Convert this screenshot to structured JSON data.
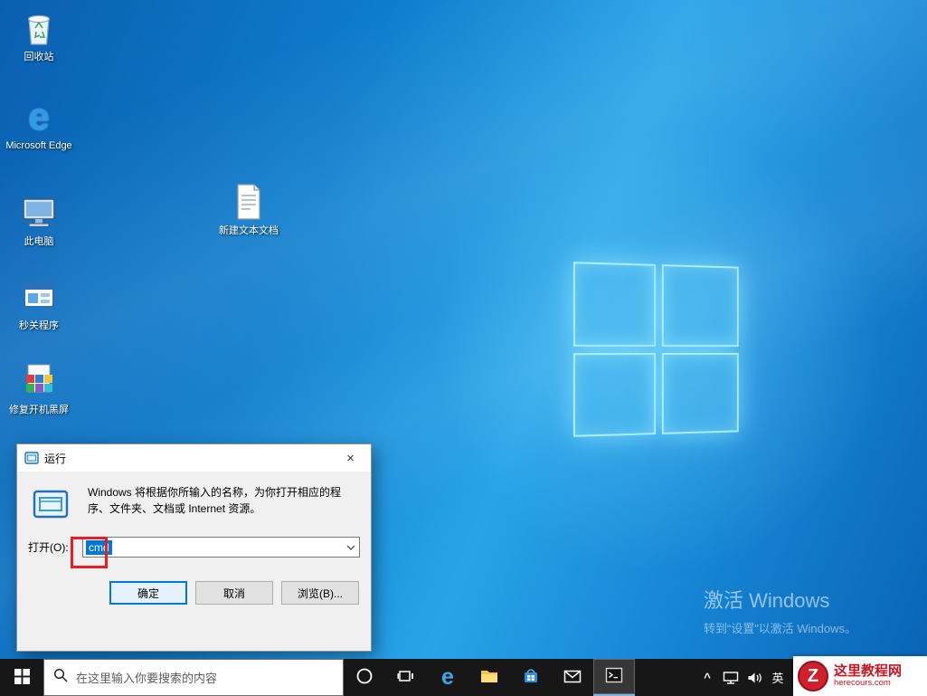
{
  "desktop": {
    "icons": [
      {
        "label": "回收站"
      },
      {
        "label": "Microsoft Edge"
      },
      {
        "label": "此电脑"
      },
      {
        "label": "秒关程序"
      },
      {
        "label": "修复开机黑屏"
      },
      {
        "label": "新建文本文档"
      }
    ],
    "activation": {
      "line1": "激活 Windows",
      "line2": "转到“设置”以激活 Windows。"
    }
  },
  "run_dialog": {
    "title": "运行",
    "description": "Windows 将根据你所输入的名称，为你打开相应的程序、文件夹、文档或 Internet 资源。",
    "open_label": "打开(O):",
    "input_value": "cmd",
    "buttons": {
      "ok": "确定",
      "cancel": "取消",
      "browse": "浏览(B)..."
    }
  },
  "taskbar": {
    "search_placeholder": "在这里输入你要搜索的内容",
    "ime_label": "英"
  },
  "icons": {
    "close_glyph": "×",
    "edge_letter": "e",
    "tray_chevron": "^"
  },
  "watermark": {
    "site_name": "这里教程网",
    "site_url": "herecours.com",
    "logo_letter": "Z"
  }
}
